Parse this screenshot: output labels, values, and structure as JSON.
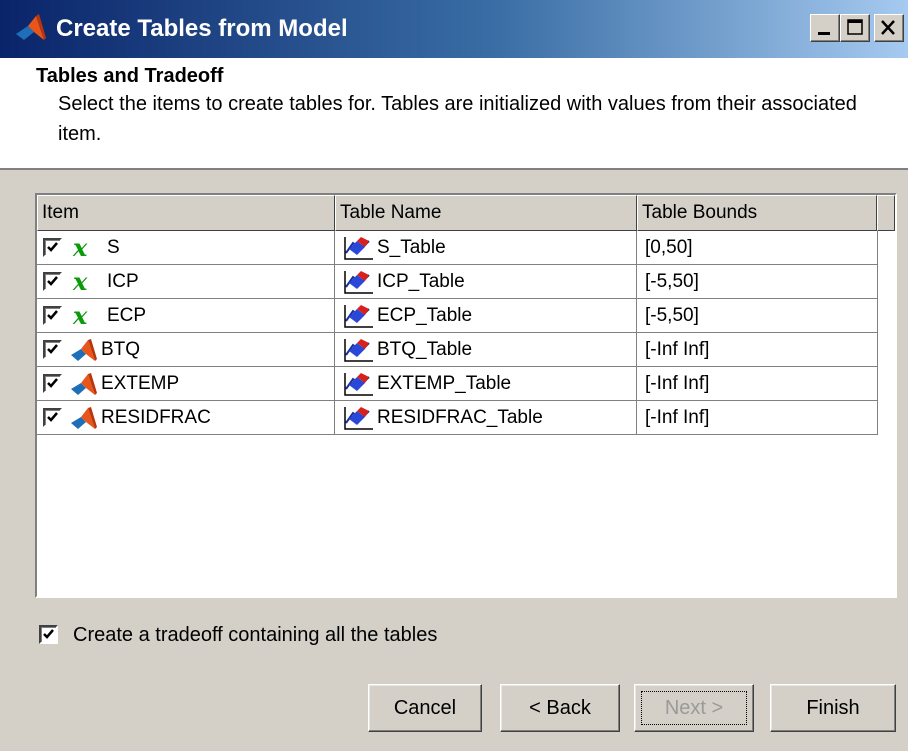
{
  "window": {
    "title": "Create Tables from Model",
    "app_icon": "matlab-logo-icon",
    "controls": [
      "minimize-icon",
      "maximize-icon",
      "close-icon"
    ]
  },
  "header": {
    "title": "Tables and Tradeoff",
    "description": "Select the items to create tables for. Tables are initialized with values from their associated item."
  },
  "table": {
    "columns": [
      "Item",
      "Table Name",
      "Table Bounds"
    ],
    "rows": [
      {
        "checked": true,
        "icon": "variable-x-icon",
        "item": "S",
        "table_name": "S_Table",
        "bounds": "[0,50]"
      },
      {
        "checked": true,
        "icon": "variable-x-icon",
        "item": "ICP",
        "table_name": "ICP_Table",
        "bounds": "[-5,50]"
      },
      {
        "checked": true,
        "icon": "variable-x-icon",
        "item": "ECP",
        "table_name": "ECP_Table",
        "bounds": "[-5,50]"
      },
      {
        "checked": true,
        "icon": "matlab-logo-icon",
        "item": "BTQ",
        "table_name": "BTQ_Table",
        "bounds": "[-Inf Inf]"
      },
      {
        "checked": true,
        "icon": "matlab-logo-icon",
        "item": "EXTEMP",
        "table_name": "EXTEMP_Table",
        "bounds": "[-Inf Inf]"
      },
      {
        "checked": true,
        "icon": "matlab-logo-icon",
        "item": "RESIDFRAC",
        "table_name": "RESIDFRAC_Table",
        "bounds": "[-Inf Inf]"
      }
    ]
  },
  "tradeoff": {
    "checked": true,
    "label": "Create a tradeoff containing all the tables"
  },
  "buttons": {
    "cancel": "Cancel",
    "back": "< Back",
    "next": "Next >",
    "finish": "Finish"
  },
  "colors": {
    "titlebar_start": "#0a246a",
    "titlebar_end": "#a6caf0",
    "dialog_face": "#d4d0c8",
    "variable_icon": "#0a9a0a",
    "disabled_text": "#9a9a9a"
  }
}
